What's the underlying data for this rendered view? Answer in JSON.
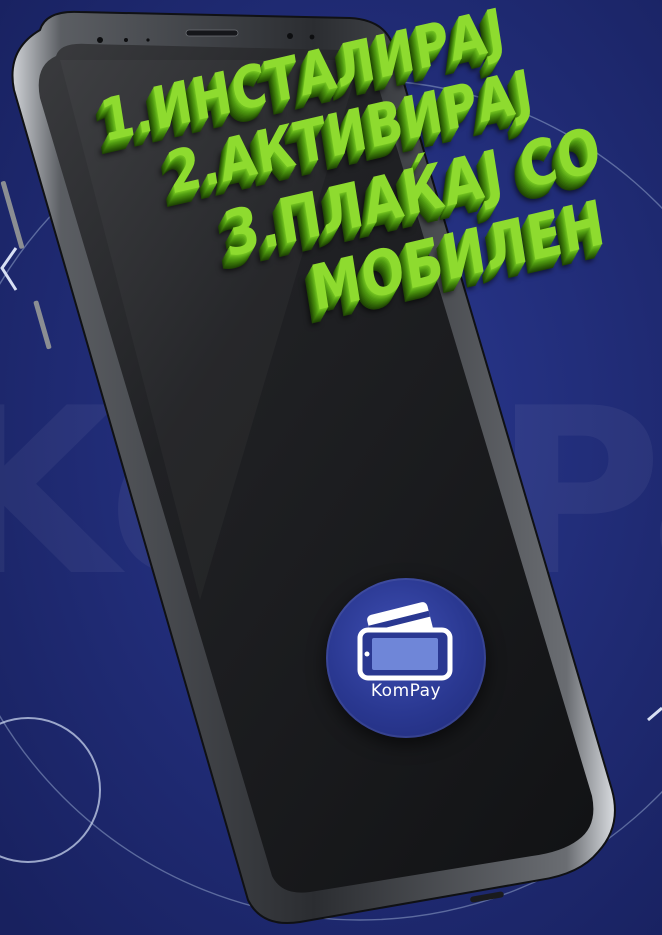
{
  "headline": {
    "line1": "1.ИНСТАЛИРАЈ",
    "line2": "2.АКТИВИРАЈ",
    "line3": "3.ПЛАЌАЈ СО",
    "line4": "МОБИЛЕН"
  },
  "app_logo": {
    "name": "KomPay",
    "icon": "phone-card-icon"
  },
  "colors": {
    "background": "#1f2b74",
    "headline_green": "#8edb2f",
    "logo_blue": "#2a3891"
  }
}
